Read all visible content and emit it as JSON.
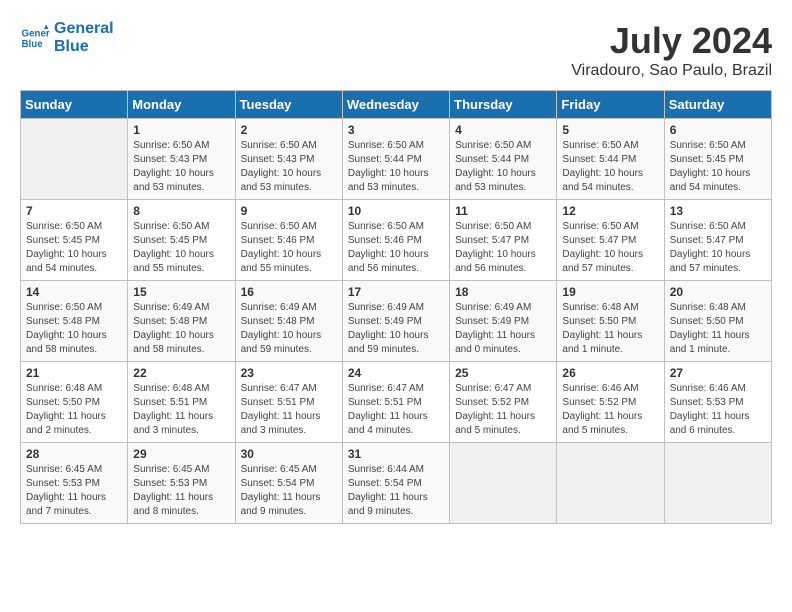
{
  "header": {
    "logo_line1": "General",
    "logo_line2": "Blue",
    "month_title": "July 2024",
    "location": "Viradouro, Sao Paulo, Brazil"
  },
  "days_of_week": [
    "Sunday",
    "Monday",
    "Tuesday",
    "Wednesday",
    "Thursday",
    "Friday",
    "Saturday"
  ],
  "weeks": [
    [
      {
        "day": "",
        "info": ""
      },
      {
        "day": "1",
        "info": "Sunrise: 6:50 AM\nSunset: 5:43 PM\nDaylight: 10 hours\nand 53 minutes."
      },
      {
        "day": "2",
        "info": "Sunrise: 6:50 AM\nSunset: 5:43 PM\nDaylight: 10 hours\nand 53 minutes."
      },
      {
        "day": "3",
        "info": "Sunrise: 6:50 AM\nSunset: 5:44 PM\nDaylight: 10 hours\nand 53 minutes."
      },
      {
        "day": "4",
        "info": "Sunrise: 6:50 AM\nSunset: 5:44 PM\nDaylight: 10 hours\nand 53 minutes."
      },
      {
        "day": "5",
        "info": "Sunrise: 6:50 AM\nSunset: 5:44 PM\nDaylight: 10 hours\nand 54 minutes."
      },
      {
        "day": "6",
        "info": "Sunrise: 6:50 AM\nSunset: 5:45 PM\nDaylight: 10 hours\nand 54 minutes."
      }
    ],
    [
      {
        "day": "7",
        "info": "Sunrise: 6:50 AM\nSunset: 5:45 PM\nDaylight: 10 hours\nand 54 minutes."
      },
      {
        "day": "8",
        "info": "Sunrise: 6:50 AM\nSunset: 5:45 PM\nDaylight: 10 hours\nand 55 minutes."
      },
      {
        "day": "9",
        "info": "Sunrise: 6:50 AM\nSunset: 5:46 PM\nDaylight: 10 hours\nand 55 minutes."
      },
      {
        "day": "10",
        "info": "Sunrise: 6:50 AM\nSunset: 5:46 PM\nDaylight: 10 hours\nand 56 minutes."
      },
      {
        "day": "11",
        "info": "Sunrise: 6:50 AM\nSunset: 5:47 PM\nDaylight: 10 hours\nand 56 minutes."
      },
      {
        "day": "12",
        "info": "Sunrise: 6:50 AM\nSunset: 5:47 PM\nDaylight: 10 hours\nand 57 minutes."
      },
      {
        "day": "13",
        "info": "Sunrise: 6:50 AM\nSunset: 5:47 PM\nDaylight: 10 hours\nand 57 minutes."
      }
    ],
    [
      {
        "day": "14",
        "info": "Sunrise: 6:50 AM\nSunset: 5:48 PM\nDaylight: 10 hours\nand 58 minutes."
      },
      {
        "day": "15",
        "info": "Sunrise: 6:49 AM\nSunset: 5:48 PM\nDaylight: 10 hours\nand 58 minutes."
      },
      {
        "day": "16",
        "info": "Sunrise: 6:49 AM\nSunset: 5:48 PM\nDaylight: 10 hours\nand 59 minutes."
      },
      {
        "day": "17",
        "info": "Sunrise: 6:49 AM\nSunset: 5:49 PM\nDaylight: 10 hours\nand 59 minutes."
      },
      {
        "day": "18",
        "info": "Sunrise: 6:49 AM\nSunset: 5:49 PM\nDaylight: 11 hours\nand 0 minutes."
      },
      {
        "day": "19",
        "info": "Sunrise: 6:48 AM\nSunset: 5:50 PM\nDaylight: 11 hours\nand 1 minute."
      },
      {
        "day": "20",
        "info": "Sunrise: 6:48 AM\nSunset: 5:50 PM\nDaylight: 11 hours\nand 1 minute."
      }
    ],
    [
      {
        "day": "21",
        "info": "Sunrise: 6:48 AM\nSunset: 5:50 PM\nDaylight: 11 hours\nand 2 minutes."
      },
      {
        "day": "22",
        "info": "Sunrise: 6:48 AM\nSunset: 5:51 PM\nDaylight: 11 hours\nand 3 minutes."
      },
      {
        "day": "23",
        "info": "Sunrise: 6:47 AM\nSunset: 5:51 PM\nDaylight: 11 hours\nand 3 minutes."
      },
      {
        "day": "24",
        "info": "Sunrise: 6:47 AM\nSunset: 5:51 PM\nDaylight: 11 hours\nand 4 minutes."
      },
      {
        "day": "25",
        "info": "Sunrise: 6:47 AM\nSunset: 5:52 PM\nDaylight: 11 hours\nand 5 minutes."
      },
      {
        "day": "26",
        "info": "Sunrise: 6:46 AM\nSunset: 5:52 PM\nDaylight: 11 hours\nand 5 minutes."
      },
      {
        "day": "27",
        "info": "Sunrise: 6:46 AM\nSunset: 5:53 PM\nDaylight: 11 hours\nand 6 minutes."
      }
    ],
    [
      {
        "day": "28",
        "info": "Sunrise: 6:45 AM\nSunset: 5:53 PM\nDaylight: 11 hours\nand 7 minutes."
      },
      {
        "day": "29",
        "info": "Sunrise: 6:45 AM\nSunset: 5:53 PM\nDaylight: 11 hours\nand 8 minutes."
      },
      {
        "day": "30",
        "info": "Sunrise: 6:45 AM\nSunset: 5:54 PM\nDaylight: 11 hours\nand 9 minutes."
      },
      {
        "day": "31",
        "info": "Sunrise: 6:44 AM\nSunset: 5:54 PM\nDaylight: 11 hours\nand 9 minutes."
      },
      {
        "day": "",
        "info": ""
      },
      {
        "day": "",
        "info": ""
      },
      {
        "day": "",
        "info": ""
      }
    ]
  ]
}
